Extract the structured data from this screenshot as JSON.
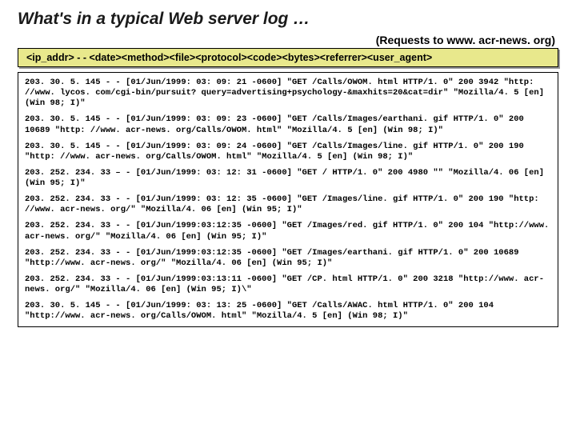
{
  "title": "What's in a typical Web server log …",
  "subtitle": "(Requests to www. acr-news. org)",
  "format_line": "<ip_addr> - - <date><method><file><protocol><code><bytes><referrer><user_agent>",
  "log_entries": [
    "203. 30. 5. 145 - - [01/Jun/1999: 03: 09: 21 -0600] \"GET /Calls/OWOM. html HTTP/1. 0\" 200 3942 \"http: //www. lycos. com/cgi-bin/pursuit? query=advertising+psychology-&maxhits=20&cat=dir\" \"Mozilla/4. 5 [en] (Win 98; I)\"",
    "203. 30. 5. 145 - - [01/Jun/1999: 03: 09: 23 -0600] \"GET /Calls/Images/earthani. gif HTTP/1. 0\" 200 10689 \"http: //www. acr-news. org/Calls/OWOM. html\" \"Mozilla/4. 5 [en] (Win 98; I)\"",
    "203. 30. 5. 145 - - [01/Jun/1999: 03: 09: 24 -0600] \"GET /Calls/Images/line. gif HTTP/1. 0\" 200 190 \"http: //www. acr-news. org/Calls/OWOM. html\" \"Mozilla/4. 5 [en] (Win 98; I)\"",
    "203. 252. 234. 33 – - [01/Jun/1999: 03: 12: 31 -0600] \"GET / HTTP/1. 0\" 200 4980 \"\" \"Mozilla/4. 06 [en] (Win 95; I)\"",
    "203. 252. 234. 33 - - [01/Jun/1999: 03: 12: 35 -0600] \"GET /Images/line. gif HTTP/1. 0\" 200 190 \"http: //www. acr-news. org/\" \"Mozilla/4. 06 [en] (Win 95; I)\"",
    "203. 252. 234. 33 - - [01/Jun/1999:03:12:35 -0600] \"GET /Images/red. gif HTTP/1. 0\" 200 104 \"http://www. acr-news. org/\" \"Mozilla/4. 06 [en] (Win 95; I)\"",
    "203. 252. 234. 33 - - [01/Jun/1999:03:12:35 -0600] \"GET /Images/earthani. gif HTTP/1. 0\" 200 10689 \"http://www. acr-news. org/\" \"Mozilla/4. 06 [en] (Win 95; I)\"",
    "203. 252. 234. 33 - - [01/Jun/1999:03:13:11 -0600] \"GET /CP. html HTTP/1. 0\" 200 3218 \"http://www. acr-news. org/\" \"Mozilla/4. 06 [en] (Win 95; I)\\\"",
    "203. 30. 5. 145 - - [01/Jun/1999: 03: 13: 25 -0600] \"GET /Calls/AWAC. html HTTP/1. 0\" 200 104 \"http://www. acr-news. org/Calls/OWOM. html\" \"Mozilla/4. 5 [en] (Win 98; I)\""
  ]
}
